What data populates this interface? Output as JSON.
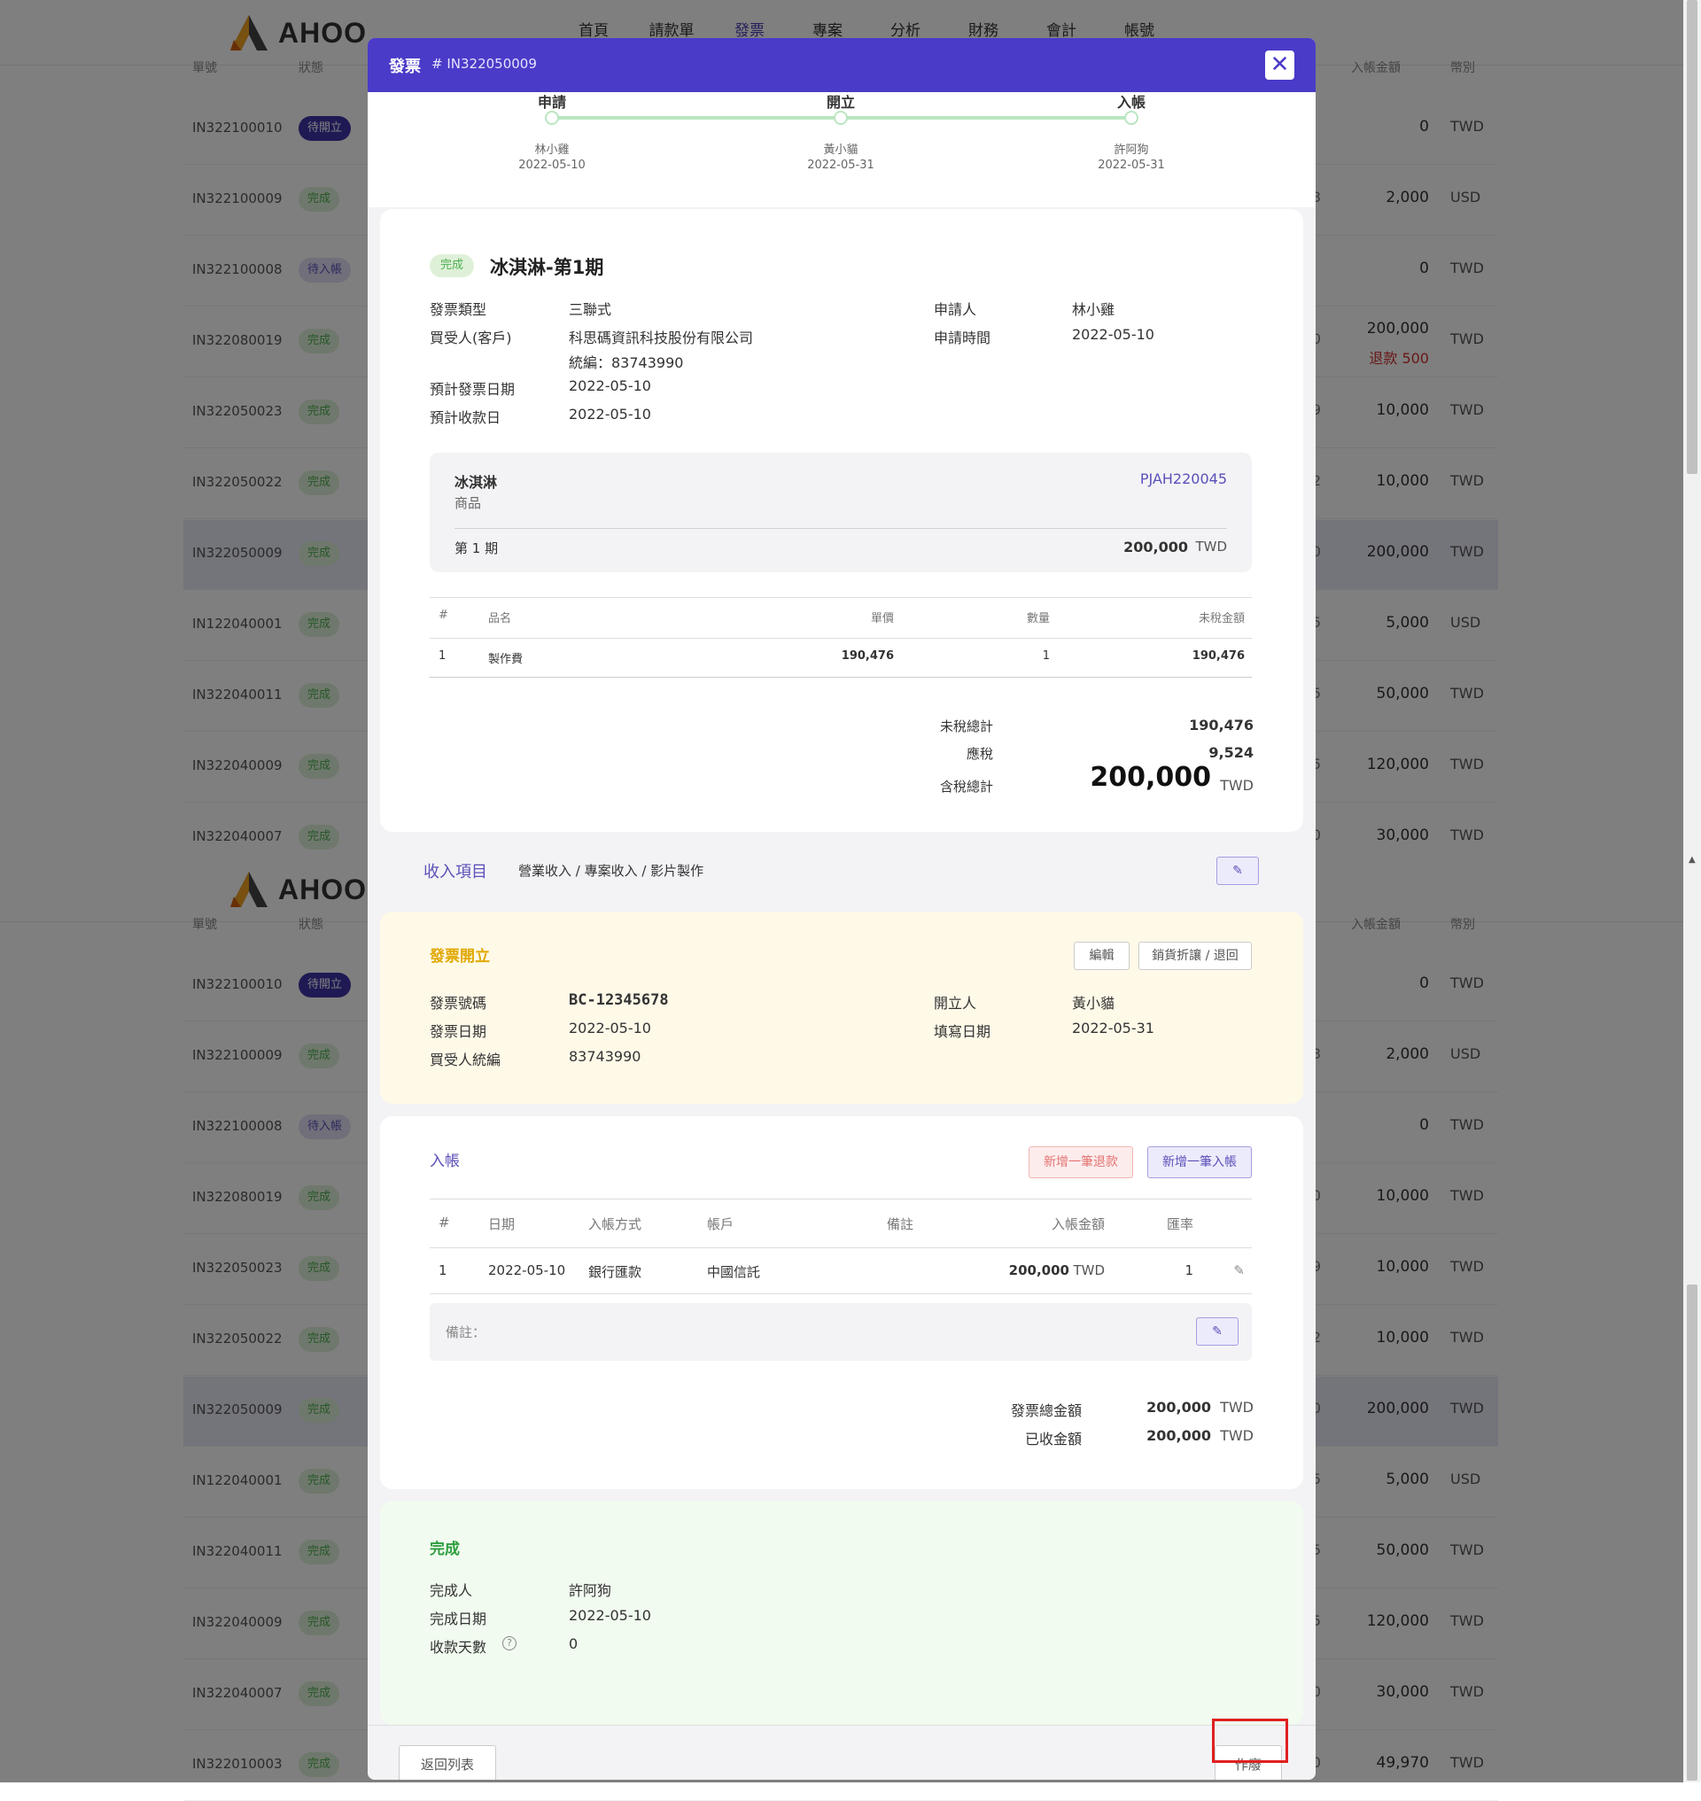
{
  "app": {
    "logo_text": "AHOO"
  },
  "nav": [
    "首頁",
    "請款單",
    "發票",
    "專案",
    "分析",
    "財務",
    "會計",
    "帳號"
  ],
  "nav_active_index": 2,
  "table_headers": {
    "id": "單號",
    "status": "狀態",
    "amount": "入帳金額",
    "currency": "幣別"
  },
  "status_labels": {
    "done": "完成",
    "open": "待開立",
    "acc": "待入帳"
  },
  "rows_top": [
    {
      "id": "IN322100010",
      "status": "open",
      "amount": "0",
      "cur": "TWD",
      "frag": ""
    },
    {
      "id": "IN322100009",
      "status": "done",
      "amount": "2,000",
      "cur": "USD",
      "frag": "3"
    },
    {
      "id": "IN322100008",
      "status": "acc",
      "amount": "0",
      "cur": "TWD",
      "frag": ""
    },
    {
      "id": "IN322080019",
      "status": "done",
      "amount": "200,000",
      "refund": "退款 500",
      "cur": "TWD",
      "frag": "0"
    },
    {
      "id": "IN322050023",
      "status": "done",
      "amount": "10,000",
      "cur": "TWD",
      "frag": "9"
    },
    {
      "id": "IN322050022",
      "status": "done",
      "amount": "10,000",
      "cur": "TWD",
      "frag": "2"
    },
    {
      "id": "IN322050009",
      "status": "done",
      "amount": "200,000",
      "cur": "TWD",
      "frag": "0",
      "hl": true
    },
    {
      "id": "IN122040001",
      "status": "done",
      "amount": "5,000",
      "cur": "USD",
      "frag": "5"
    },
    {
      "id": "IN322040011",
      "status": "done",
      "amount": "50,000",
      "cur": "TWD",
      "frag": "5"
    },
    {
      "id": "IN322040009",
      "status": "done",
      "amount": "120,000",
      "cur": "TWD",
      "frag": "5"
    },
    {
      "id": "IN322040007",
      "status": "done",
      "amount": "30,000",
      "cur": "TWD",
      "frag": "0"
    }
  ],
  "rows_bottom": [
    {
      "id": "IN322100010",
      "status": "open",
      "amount": "0",
      "cur": "TWD",
      "frag": ""
    },
    {
      "id": "IN322100009",
      "status": "done",
      "amount": "2,000",
      "cur": "USD",
      "frag": "3"
    },
    {
      "id": "IN322100008",
      "status": "acc",
      "amount": "0",
      "cur": "TWD",
      "frag": ""
    },
    {
      "id": "IN322080019",
      "status": "done",
      "amount": "10,000",
      "cur": "TWD",
      "frag": "0"
    },
    {
      "id": "IN322050023",
      "status": "done",
      "amount": "10,000",
      "cur": "TWD",
      "frag": "9"
    },
    {
      "id": "IN322050022",
      "status": "done",
      "amount": "10,000",
      "cur": "TWD",
      "frag": "2"
    },
    {
      "id": "IN322050009",
      "status": "done",
      "amount": "200,000",
      "cur": "TWD",
      "frag": "0",
      "hl": true
    },
    {
      "id": "IN122040001",
      "status": "done",
      "amount": "5,000",
      "cur": "USD",
      "frag": "5"
    },
    {
      "id": "IN322040011",
      "status": "done",
      "amount": "50,000",
      "cur": "TWD",
      "frag": "5"
    },
    {
      "id": "IN322040009",
      "status": "done",
      "amount": "120,000",
      "cur": "TWD",
      "frag": "5"
    },
    {
      "id": "IN322040007",
      "status": "done",
      "amount": "30,000",
      "cur": "TWD",
      "frag": "0"
    },
    {
      "id": "IN322010003",
      "status": "done",
      "amount": "49,970",
      "cur": "TWD",
      "frag": "0"
    }
  ],
  "modal": {
    "title": "發票",
    "number": "# IN322050009",
    "steps": [
      {
        "label": "申請",
        "person": "林小雞",
        "date": "2022-05-10"
      },
      {
        "label": "開立",
        "person": "黃小貓",
        "date": "2022-05-31"
      },
      {
        "label": "入帳",
        "person": "許阿狗",
        "date": "2022-05-31"
      }
    ],
    "status_badge": "完成",
    "name": "冰淇淋-第1期",
    "info_left": [
      {
        "k": "發票類型",
        "v": "三聯式"
      },
      {
        "k": "買受人(客戶)",
        "v": "科思碼資訊科技股份有限公司",
        "v2": "統編：83743990"
      },
      {
        "k": "預計發票日期",
        "v": "2022-05-10"
      },
      {
        "k": "預計收款日",
        "v": "2022-05-10"
      }
    ],
    "info_right": [
      {
        "k": "申請人",
        "v": "林小雞"
      },
      {
        "k": "申請時間",
        "v": "2022-05-10"
      }
    ],
    "project": {
      "name": "冰淇淋",
      "type": "商品",
      "code": "PJAH220045",
      "period": "第 1 期",
      "amount": "200,000",
      "cur": "TWD"
    },
    "items_headers": [
      "#",
      "品名",
      "單價",
      "數量",
      "未稅金額"
    ],
    "items": [
      {
        "no": "1",
        "name": "製作費",
        "price": "190,476",
        "qty": "1",
        "subtotal": "190,476"
      }
    ],
    "totals": {
      "pretax_label": "未稅總計",
      "pretax": "190,476",
      "tax_label": "應稅",
      "tax": "9,524",
      "total_label": "含稅總計",
      "total": "200,000",
      "cur": "TWD"
    },
    "income": {
      "label": "收入項目",
      "path": "營業收入 / 專案收入 / 影片製作"
    },
    "issue": {
      "title": "發票開立",
      "edit_btn": "編輯",
      "discount_btn": "銷貨折讓 / 退回",
      "fields_left": [
        {
          "k": "發票號碼",
          "v": "BC-12345678"
        },
        {
          "k": "發票日期",
          "v": "2022-05-10"
        },
        {
          "k": "買受人統編",
          "v": "83743990"
        }
      ],
      "fields_right": [
        {
          "k": "開立人",
          "v": "黃小貓"
        },
        {
          "k": "填寫日期",
          "v": "2022-05-31"
        }
      ]
    },
    "account": {
      "title": "入帳",
      "refund_btn": "新增一筆退款",
      "add_btn": "新增一筆入帳",
      "headers": [
        "#",
        "日期",
        "入帳方式",
        "帳戶",
        "備註",
        "入帳金額",
        "匯率"
      ],
      "rows": [
        {
          "no": "1",
          "date": "2022-05-10",
          "method": "銀行匯款",
          "account": "中國信託",
          "note": "",
          "amount": "200,000",
          "cur": "TWD",
          "rate": "1"
        }
      ],
      "remark_label": "備註：",
      "sum_invoice_label": "發票總金額",
      "sum_invoice": "200,000",
      "sum_received_label": "已收金額",
      "sum_received": "200,000",
      "cur": "TWD"
    },
    "done": {
      "title": "完成",
      "fields": [
        {
          "k": "完成人",
          "v": "許阿狗"
        },
        {
          "k": "完成日期",
          "v": "2022-05-10"
        },
        {
          "k": "收款天數",
          "v": "0"
        }
      ]
    },
    "footer": {
      "back": "返回列表",
      "void": "作廢"
    }
  }
}
